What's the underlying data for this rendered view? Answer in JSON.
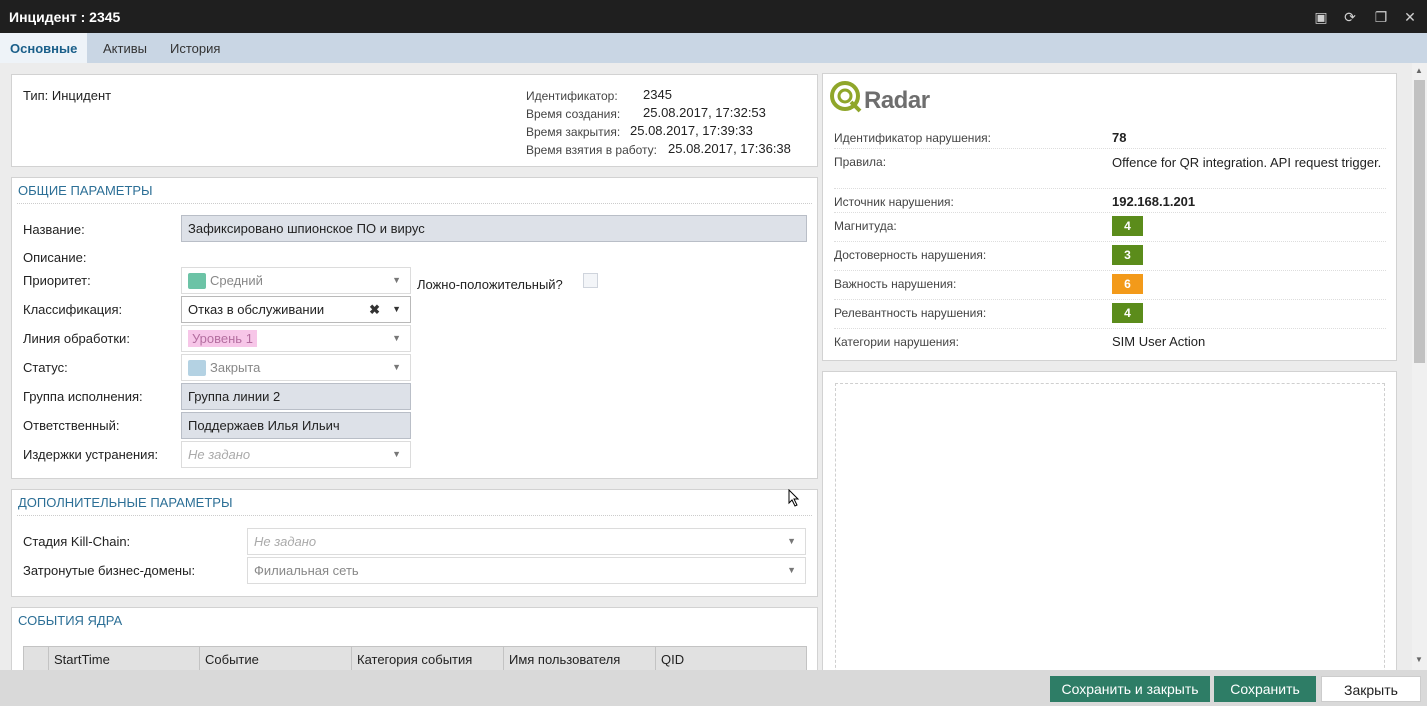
{
  "window": {
    "title": "Инцидент : 2345"
  },
  "tabs": [
    {
      "label": "Основные"
    },
    {
      "label": "Активы"
    },
    {
      "label": "История"
    }
  ],
  "header": {
    "type_label": "Тип: Инцидент",
    "meta": [
      {
        "label": "Идентификатор:",
        "value": "2345"
      },
      {
        "label": "Время создания:",
        "value": "25.08.2017, 17:32:53"
      },
      {
        "label": "Время закрытия:",
        "value": "25.08.2017, 17:39:33"
      },
      {
        "label": "Время взятия в работу:",
        "value": "25.08.2017, 17:36:38"
      }
    ]
  },
  "general": {
    "title": "ОБЩИЕ ПАРАМЕТРЫ",
    "name": {
      "label": "Название:",
      "value": "Зафиксировано шпионское ПО и вирус"
    },
    "description": {
      "label": "Описание:"
    },
    "priority": {
      "label": "Приоритет:",
      "value": "Средний",
      "color": "#6cc3a6"
    },
    "false_positive": {
      "label": "Ложно-положительный?"
    },
    "classification": {
      "label": "Классификация:",
      "value": "Отказ в обслуживании"
    },
    "line": {
      "label": "Линия обработки:",
      "value": "Уровень 1",
      "color": "#f7c6e8"
    },
    "status": {
      "label": "Статус:",
      "value": "Закрыта",
      "color": "#b4d2e3"
    },
    "group": {
      "label": "Группа исполнения:",
      "value": "Группа линии 2"
    },
    "responsible": {
      "label": "Ответственный:",
      "value": "Поддержаев Илья Ильич"
    },
    "costs": {
      "label": "Издержки устранения:",
      "placeholder": "Не задано"
    }
  },
  "extra": {
    "title": "ДОПОЛНИТЕЛЬНЫЕ ПАРАМЕТРЫ",
    "kill_chain": {
      "label": "Стадия Kill-Chain:",
      "placeholder": "Не задано"
    },
    "domains": {
      "label": "Затронутые бизнес-домены:",
      "value": "Филиальная сеть"
    }
  },
  "events": {
    "title": "СОБЫТИЯ ЯДРА",
    "columns": [
      "StartTime",
      "Событие",
      "Категория события",
      "Имя пользователя",
      "QID"
    ]
  },
  "radar": {
    "logo": "Radar",
    "rows": [
      {
        "label": "Идентификатор нарушения:",
        "value": "78"
      },
      {
        "label": "Правила:",
        "value": "Offence for QR integration. API request trigger."
      },
      {
        "label": "Источник нарушения:",
        "value": "192.168.1.201"
      },
      {
        "label": "Магнитуда:",
        "value": "4",
        "color": "#5b8c1b"
      },
      {
        "label": "Достоверность нарушения:",
        "value": "3",
        "color": "#5b8c1b"
      },
      {
        "label": "Важность нарушения:",
        "value": "6",
        "color": "#f39a1a"
      },
      {
        "label": "Релевантность нарушения:",
        "value": "4",
        "color": "#5b8c1b"
      },
      {
        "label": "Категории нарушения:",
        "value": "SIM User Action"
      }
    ]
  },
  "footer": {
    "save_close": "Сохранить и закрыть",
    "save": "Сохранить",
    "close": "Закрыть"
  },
  "colors": {
    "titlebar": "#1f1f1f",
    "tabbar": "#c9d6e4",
    "accent": "#2c6f96",
    "primary_button": "#2e7d66"
  }
}
